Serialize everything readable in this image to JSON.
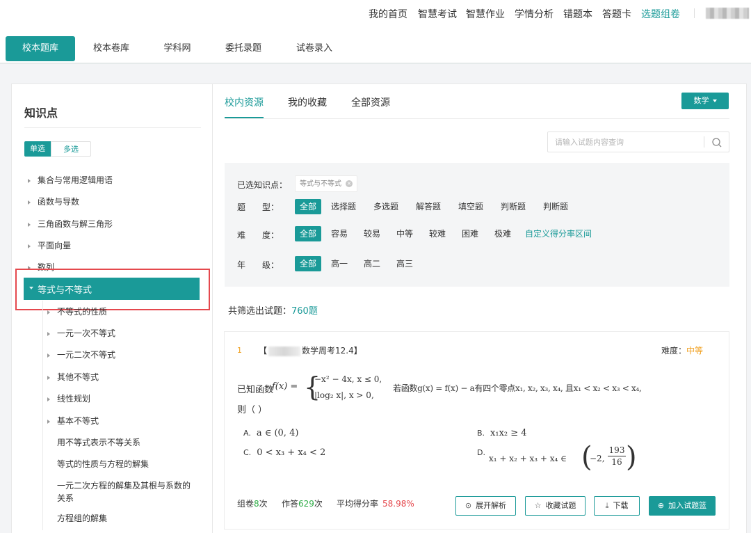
{
  "topnav": {
    "items": [
      "我的首页",
      "智慧考试",
      "智慧作业",
      "学情分析",
      "错题本",
      "答题卡",
      "选题组卷"
    ],
    "active_index": 6
  },
  "tabs": [
    "校本题库",
    "校本卷库",
    "学科网",
    "委托录题",
    "试卷录入"
  ],
  "sidebar": {
    "title": "知识点",
    "mode": {
      "single": "单选",
      "multi": "多选"
    },
    "items": [
      "集合与常用逻辑用语",
      "函数与导数",
      "三角函数与解三角形",
      "平面向量",
      "数列"
    ],
    "active": "等式与不等式",
    "children": [
      "不等式的性质",
      "一元一次不等式",
      "一元二次不等式",
      "其他不等式",
      "线性规划",
      "基本不等式",
      "用不等式表示不等关系",
      "等式的性质与方程的解集",
      "一元二次方程的解集及其根与系数的",
      "关系",
      "方程组的解集"
    ]
  },
  "main": {
    "tabs": [
      "校内资源",
      "我的收藏",
      "全部资源"
    ],
    "subject": "数学",
    "search_placeholder": "请输入试题内容查询"
  },
  "filters": {
    "selected_label": "已选知识点：",
    "selected_tag": "等式与不等式",
    "type_label": "题　　型：",
    "types": [
      "全部",
      "选择题",
      "多选题",
      "解答题",
      "填空题",
      "判断题",
      "判断题"
    ],
    "difficulty_label": "难　　度：",
    "difficulties": [
      "全部",
      "容易",
      "较易",
      "中等",
      "较难",
      "困难",
      "极难"
    ],
    "custom_link": "自定义得分率区间",
    "grade_label": "年　　级：",
    "grades": [
      "全部",
      "高一",
      "高二",
      "高三"
    ]
  },
  "result": {
    "prefix": "共筛选出试题：",
    "count": "760题"
  },
  "question": {
    "number": "1",
    "source_open": "【",
    "source": "数学周考12.4】",
    "difficulty_label": "难度：",
    "difficulty": "中等",
    "stem_prefix": "已知函数",
    "fx": "f(x) =",
    "case1": "−x² − 4x, x ≤ 0,",
    "case2": "|log₂ x|, x > 0,",
    "stem_mid": "若函数g(x) = f(x) − a有四个零点x₁, x₂, x₃, x₄, 且x₁ < x₂ < x₃ < x₄,",
    "stem_end": "则（  ）",
    "options": {
      "A": {
        "key": "A.",
        "text": "a ∈ (0, 4)"
      },
      "B": {
        "key": "B.",
        "text": "x₁x₂ ≥ 4"
      },
      "C": {
        "key": "C.",
        "text": "0 < x₃ + x₄ < 2"
      },
      "D": {
        "key": "D.",
        "text": "x₁ + x₂ + x₃ + x₄ ∈",
        "inner": "−2,",
        "num": "193",
        "den": "16"
      }
    },
    "stats": {
      "zujuan_label": "组卷",
      "zujuan": "8",
      "zujuan_unit": "次",
      "zuoda_label": "作答",
      "zuoda": "629",
      "zuoda_unit": "次",
      "avg_label": "平均得分率",
      "avg": "58.98%"
    },
    "buttons": {
      "expand": "展开解析",
      "fav": "收藏试题",
      "download": "下载",
      "add": "加入试题篮"
    }
  },
  "colors": {
    "accent": "#1a9a98",
    "warning": "#f0a020",
    "danger": "#e5484d",
    "success": "#2dab46"
  }
}
